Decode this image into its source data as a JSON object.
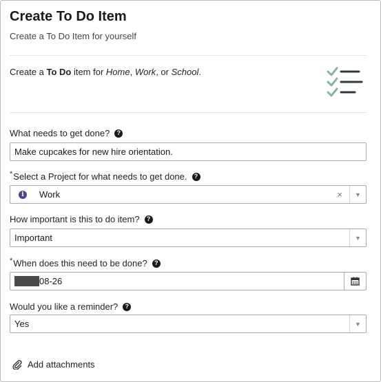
{
  "header": {
    "title": "Create To Do Item",
    "subtitle": "Create a To Do Item for yourself"
  },
  "intro": {
    "prefix": "Create a ",
    "bold": "To Do",
    "middle": " item for ",
    "home": "Home",
    "comma1": ", ",
    "work": "Work",
    "comma2": ", or ",
    "school": "School",
    "suffix": "."
  },
  "task": {
    "label": "What needs to get done?",
    "value": "Make cupcakes for new hire orientation."
  },
  "project": {
    "required_mark": "*",
    "label": "Select a Project for what needs to get done.",
    "value": "Work",
    "clear": "×"
  },
  "importance": {
    "label": "How important is this to do item?",
    "value": "Important"
  },
  "due_date": {
    "required_mark": "*",
    "label": "When does this need to be done?",
    "visible_value": "08-26"
  },
  "reminder": {
    "label": "Would you like a reminder?",
    "value": "Yes"
  },
  "attachments": {
    "label": "Add attachments"
  },
  "icons": {
    "help": "?",
    "info": "i",
    "caret": "▼"
  },
  "colors": {
    "check_green": "#7fb79b",
    "list_dark": "#2f3a40",
    "border": "#a9a9a9"
  }
}
